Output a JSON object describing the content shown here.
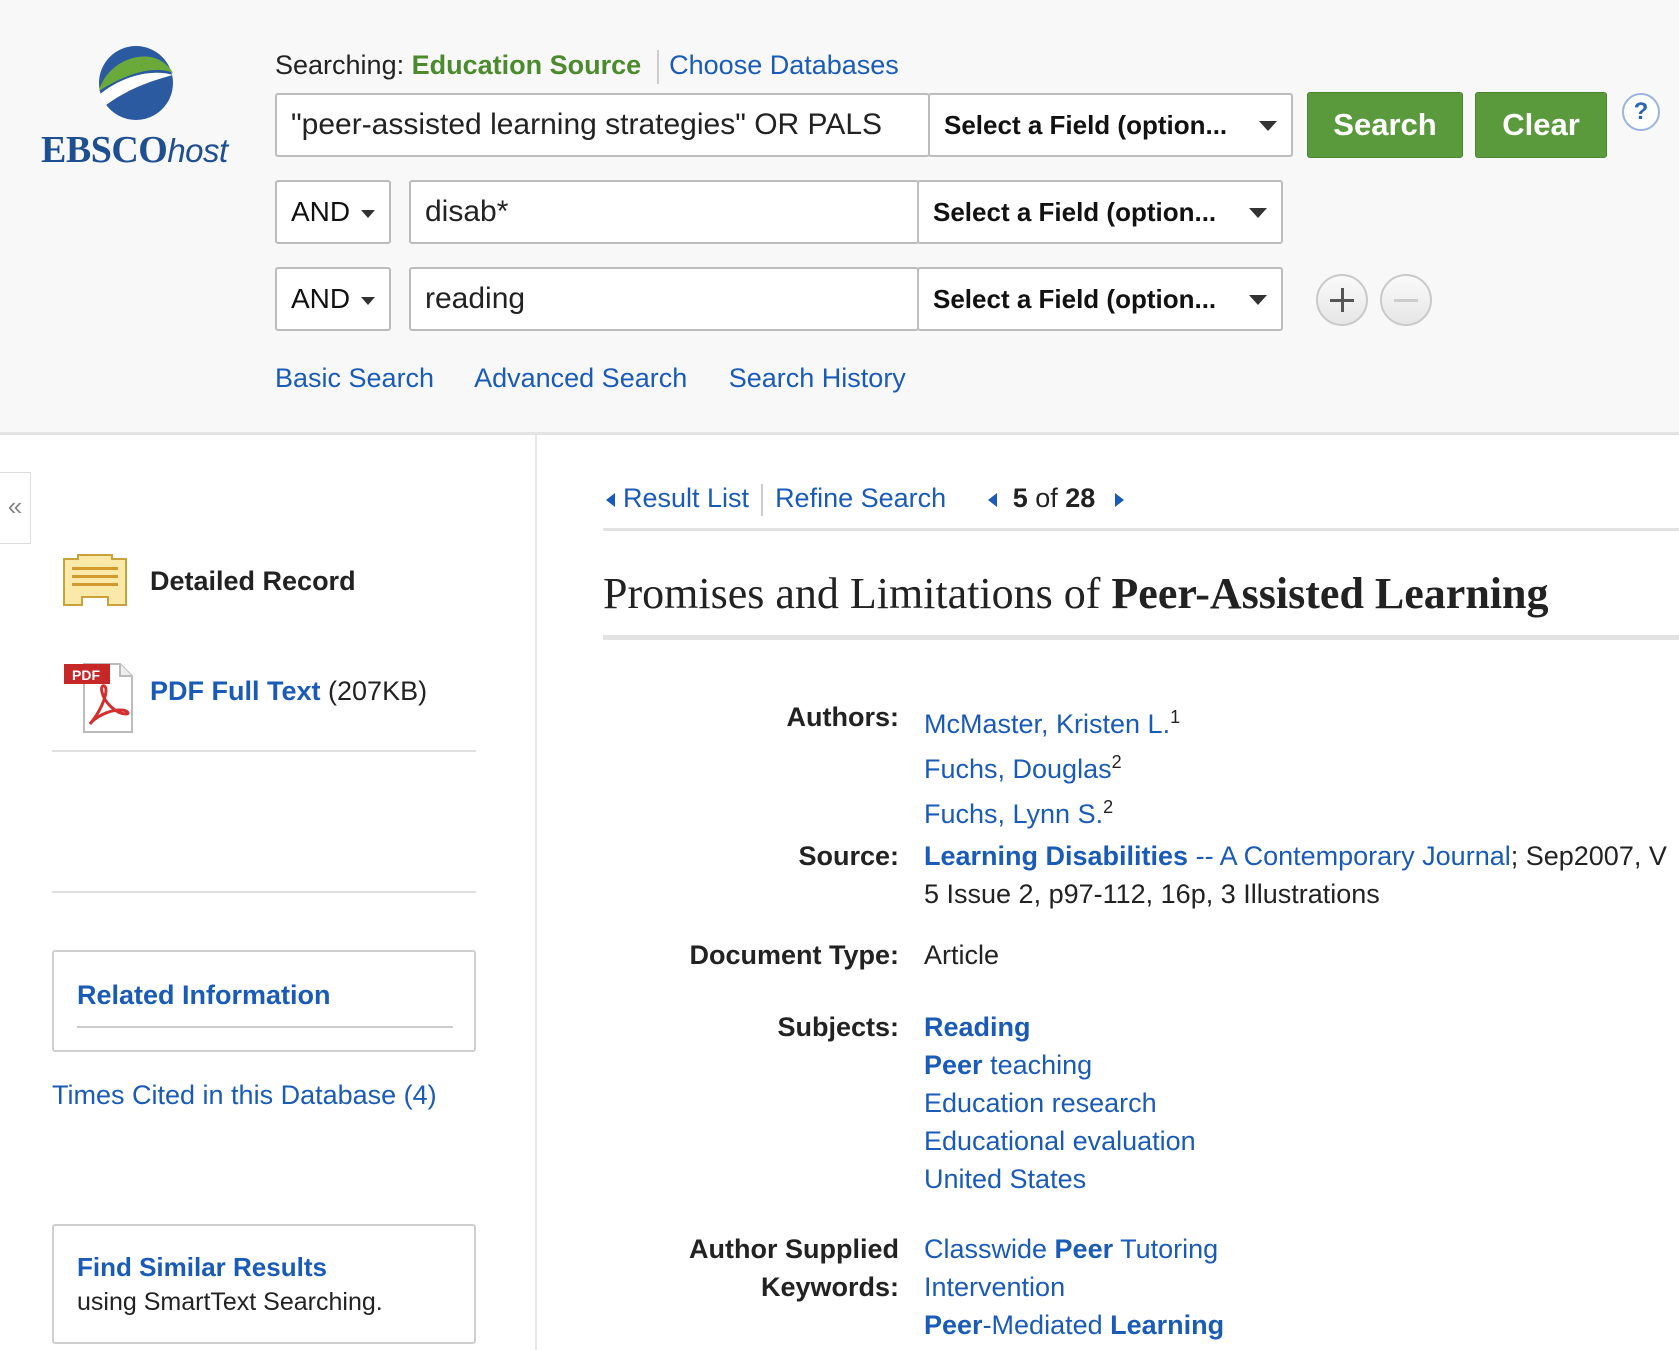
{
  "header": {
    "logo_text_bold": "EBSCO",
    "logo_text_italic": "host",
    "searching_label": "Searching:",
    "database_name": "Education Source",
    "choose_databases": "Choose Databases",
    "query_rows": [
      {
        "term": "\"peer-assisted learning strategies\" OR PALS",
        "field": "Select a Field (option..."
      },
      {
        "operator": "AND",
        "term": "disab*",
        "field": "Select a Field (option..."
      },
      {
        "operator": "AND",
        "term": "reading",
        "field": "Select a Field (option..."
      }
    ],
    "search_button": "Search",
    "clear_button": "Clear",
    "help": "?",
    "nav_links": [
      "Basic Search",
      "Advanced Search",
      "Search History"
    ]
  },
  "sidebar": {
    "collapse": "«",
    "detailed_record": "Detailed Record",
    "pdf_label": "PDF Full Text",
    "pdf_size": "(207KB)",
    "pdf_icon_text": "PDF",
    "related_information": "Related Information",
    "times_cited": "Times Cited in this Database (4)",
    "find_similar": "Find Similar Results",
    "find_similar_sub": "using SmartText Searching."
  },
  "record": {
    "result_list": "Result List",
    "refine_search": "Refine Search",
    "position_current": "5",
    "position_of": "of",
    "position_total": "28",
    "title_plain": "Promises and Limitations of ",
    "title_bold": "Peer-Assisted Learning",
    "authors_label": "Authors:",
    "authors": [
      {
        "name": "McMaster, Kristen L.",
        "sup": "1"
      },
      {
        "name": "Fuchs, Douglas",
        "sup": "2"
      },
      {
        "name": "Fuchs, Lynn S.",
        "sup": "2"
      }
    ],
    "source_label": "Source:",
    "source_journal_bold": "Learning Disabilities",
    "source_journal_rest": " -- A Contemporary Journal",
    "source_rest_line1": "; Sep2007, V",
    "source_line2": "5 Issue 2, p97-112, 16p, 3 Illustrations",
    "doctype_label": "Document Type:",
    "doctype": "Article",
    "subjects_label": "Subjects:",
    "subjects": {
      "s1_bold": "Reading",
      "s2_bold": "Peer",
      "s2_rest": " teaching",
      "s3": "Education research",
      "s4": "Educational evaluation",
      "s5": "United States"
    },
    "keywords_label_1": "Author Supplied",
    "keywords_label_2": "Keywords:",
    "keywords": {
      "k1_pre": "Classwide ",
      "k1_bold": "Peer",
      "k1_post": " Tutoring",
      "k2": "Intervention",
      "k3_bold1": "Peer",
      "k3_mid": "-Mediated ",
      "k3_bold2": "Learning"
    }
  },
  "colors": {
    "link": "#1a5bb8",
    "green_button": "#5a9a3c",
    "database_green": "#4c8a2e",
    "logo_blue": "#1d4f91"
  }
}
